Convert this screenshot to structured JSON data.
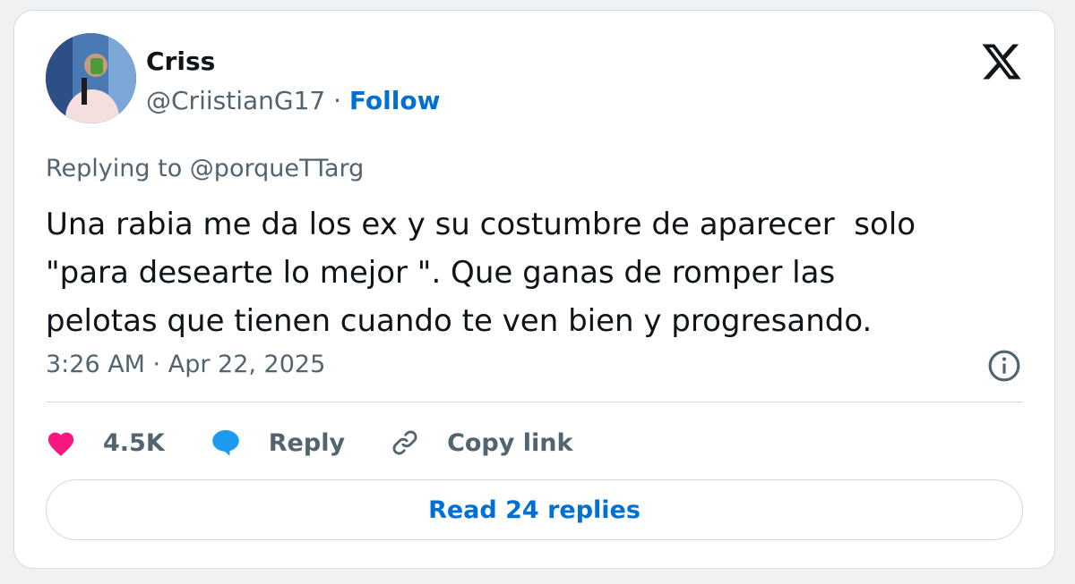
{
  "author": {
    "name": "Criss",
    "handle": "@CriistianG17",
    "separator": " · ",
    "follow_label": "Follow"
  },
  "tweet": {
    "replying_to": "Replying to @porqueTTarg",
    "text": "Una rabia me da los ex y su costumbre de aparecer  solo\n\"para desearte lo mejor \". Que ganas de romper las\npelotas que tienen cuando te ven bien y progresando.",
    "timestamp": "3:26 AM · Apr 22, 2025"
  },
  "actions": {
    "like_count": "4.5K",
    "reply_label": "Reply",
    "copy_link_label": "Copy link"
  },
  "read_replies_label": "Read 24 replies",
  "icons": {
    "logo": "x-logo-icon",
    "info": "info-icon",
    "like": "heart-icon",
    "reply": "speech-bubble-icon",
    "copy": "link-icon"
  },
  "colors": {
    "follow": "#006fd6",
    "heart": "#f91880",
    "reply_bubble": "#1d9bf0",
    "secondary_text": "#536471",
    "primary_text": "#0f1419"
  }
}
